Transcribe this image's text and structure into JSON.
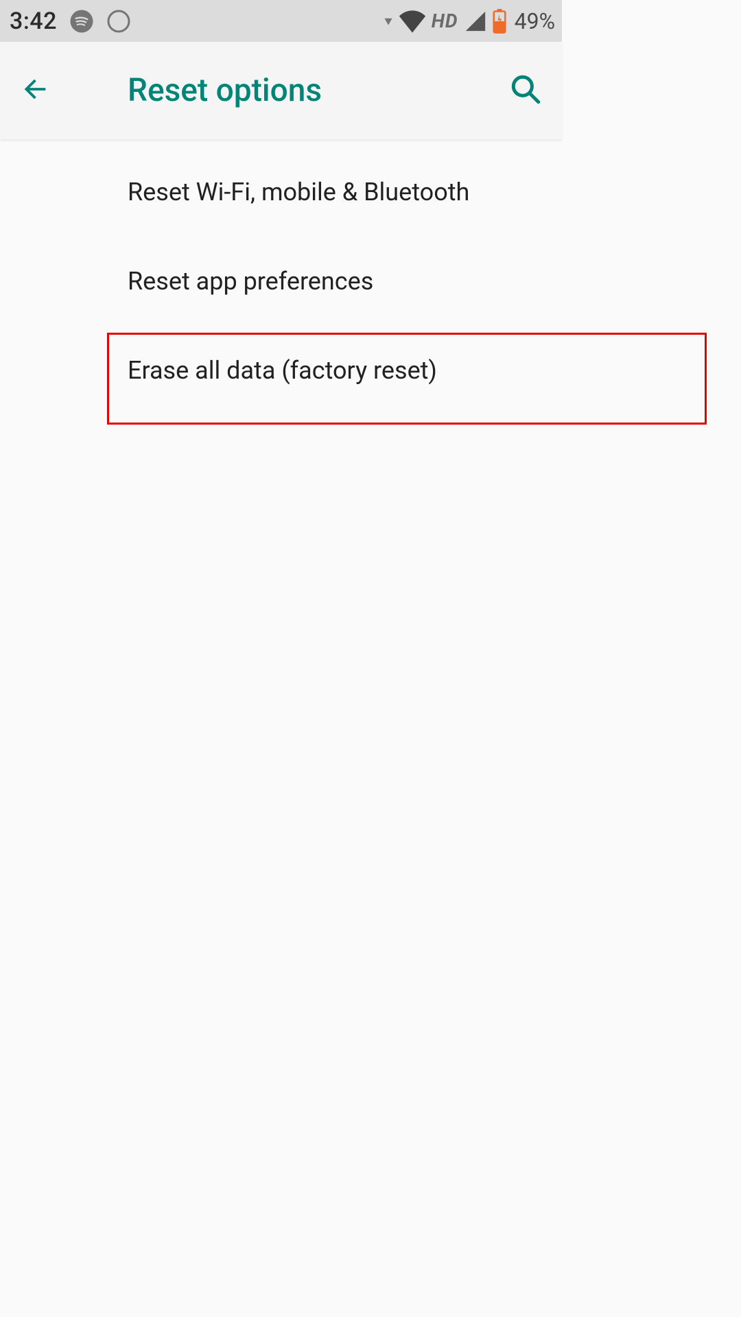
{
  "status_bar": {
    "time": "3:42",
    "hd_label": "HD",
    "battery_pct": "49%"
  },
  "appbar": {
    "title": "Reset options"
  },
  "options": [
    {
      "label": "Reset Wi-Fi, mobile & Bluetooth"
    },
    {
      "label": "Reset app preferences"
    },
    {
      "label": "Erase all data (factory reset)"
    }
  ],
  "colors": {
    "accent": "#008477",
    "status_icon": "#757575",
    "battery_body": "#f06a2a",
    "highlight_border": "#e20000"
  }
}
